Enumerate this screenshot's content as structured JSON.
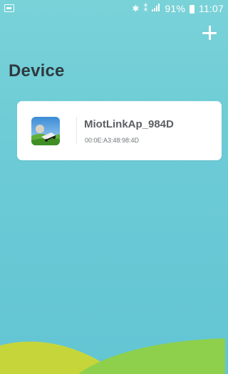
{
  "status_bar": {
    "left_icon": "image-notification-icon",
    "right_icons": [
      "bluetooth-icon",
      "vibrate-icon",
      "signal-icon"
    ],
    "signal_glyph": "",
    "battery_percent": "91%",
    "time": "11:07"
  },
  "header": {
    "add_button_icon": "plus-icon",
    "title": "Device"
  },
  "devices": [
    {
      "name": "MiotLinkAp_984D",
      "mac": "00:0E:A3:48:98:4D",
      "thumbnail": "robot-mower-thumbnail"
    }
  ],
  "colors": {
    "background_top": "#79d2d8",
    "background_bottom": "#63c5d3",
    "hill_green": "#8ed04b",
    "hill_yellow": "#c6d63a",
    "title": "#2f3a3f"
  }
}
